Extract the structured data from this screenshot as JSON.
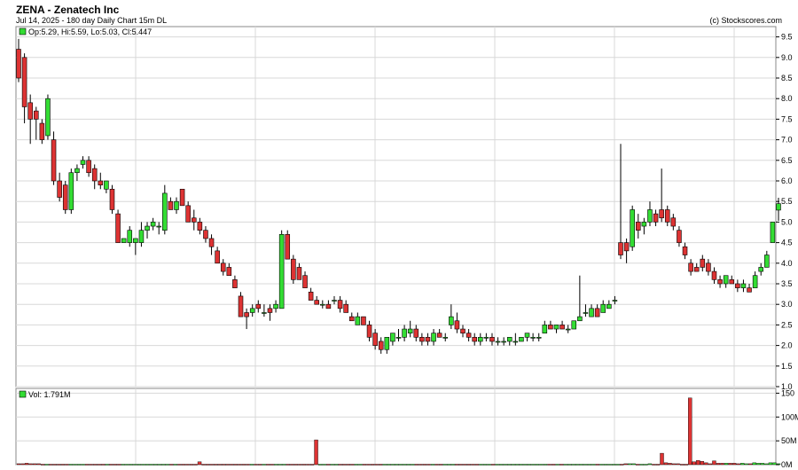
{
  "header": {
    "title": "ZENA - Zenatech Inc",
    "subtitle": "Jul 14, 2025 - 180 day  Daily Chart 15m DL",
    "copyright": "(c) Stockscores.com"
  },
  "price_legend": "Op:5.29, Hi:5.59, Lo:5.03, Cl:5.447",
  "volume_legend": "Vol: 1.791M",
  "colors": {
    "up": "#33dd33",
    "down": "#dd3333",
    "grid": "#d8d8d8",
    "frame": "#888888"
  },
  "chart_data": [
    {
      "type": "candlestick",
      "title": "ZENA - Zenatech Inc",
      "ylim": [
        1.0,
        9.75
      ],
      "yticks": [
        "1.0",
        "1.5",
        "2.0",
        "2.5",
        "3.0",
        "3.5",
        "4.0",
        "4.5",
        "5.0",
        "5.5",
        "6.0",
        "6.5",
        "7.0",
        "7.5",
        "8.0",
        "8.5",
        "9.0",
        "9.5"
      ],
      "grid": true,
      "candles": [
        [
          9.2,
          9.45,
          8.4,
          8.5
        ],
        [
          9.0,
          9.1,
          7.4,
          7.8
        ],
        [
          7.9,
          8.1,
          6.9,
          7.5
        ],
        [
          7.7,
          7.8,
          7.0,
          7.5
        ],
        [
          7.4,
          7.5,
          6.9,
          7.0
        ],
        [
          7.1,
          8.1,
          7.0,
          8.0
        ],
        [
          7.0,
          7.2,
          5.9,
          6.0
        ],
        [
          6.0,
          6.2,
          5.5,
          5.6
        ],
        [
          5.9,
          6.0,
          5.2,
          5.3
        ],
        [
          5.3,
          6.3,
          5.2,
          6.2
        ],
        [
          6.2,
          6.4,
          6.0,
          6.3
        ],
        [
          6.4,
          6.6,
          6.3,
          6.5
        ],
        [
          6.5,
          6.6,
          6.1,
          6.2
        ],
        [
          6.3,
          6.4,
          5.8,
          6.0
        ],
        [
          6.0,
          6.2,
          5.8,
          5.9
        ],
        [
          5.8,
          6.0,
          5.7,
          6.0
        ],
        [
          5.8,
          5.9,
          5.2,
          5.3
        ],
        [
          5.2,
          5.3,
          4.5,
          4.5
        ],
        [
          4.5,
          4.6,
          4.5,
          4.6
        ],
        [
          4.5,
          4.9,
          4.4,
          4.8
        ],
        [
          4.5,
          4.6,
          4.2,
          4.6
        ],
        [
          4.5,
          5.0,
          4.4,
          4.8
        ],
        [
          4.8,
          5.0,
          4.6,
          4.9
        ],
        [
          4.9,
          5.1,
          4.8,
          5.0
        ],
        [
          4.9,
          5.0,
          4.7,
          4.9
        ],
        [
          4.8,
          5.9,
          4.7,
          5.7
        ],
        [
          5.5,
          5.6,
          5.3,
          5.3
        ],
        [
          5.3,
          5.6,
          5.2,
          5.5
        ],
        [
          5.8,
          5.8,
          5.4,
          5.4
        ],
        [
          5.4,
          5.5,
          5.0,
          5.0
        ],
        [
          5.1,
          5.3,
          4.8,
          5.0
        ],
        [
          5.0,
          5.1,
          4.7,
          4.8
        ],
        [
          4.8,
          4.9,
          4.5,
          4.6
        ],
        [
          4.6,
          4.7,
          4.2,
          4.4
        ],
        [
          4.3,
          4.4,
          4.0,
          4.0
        ],
        [
          4.0,
          4.1,
          3.7,
          3.8
        ],
        [
          3.9,
          4.0,
          3.7,
          3.7
        ],
        [
          3.6,
          3.7,
          3.4,
          3.4
        ],
        [
          3.2,
          3.3,
          2.7,
          2.7
        ],
        [
          2.8,
          2.9,
          2.4,
          2.7
        ],
        [
          2.8,
          3.0,
          2.7,
          2.9
        ],
        [
          3.0,
          3.1,
          2.8,
          2.9
        ],
        [
          2.8,
          3.0,
          2.7,
          2.8
        ],
        [
          2.9,
          3.0,
          2.6,
          2.8
        ],
        [
          2.9,
          3.1,
          2.8,
          3.0
        ],
        [
          2.9,
          4.8,
          2.9,
          4.7
        ],
        [
          4.7,
          4.8,
          4.1,
          4.1
        ],
        [
          4.1,
          4.2,
          3.5,
          3.6
        ],
        [
          3.9,
          4.0,
          3.6,
          3.6
        ],
        [
          3.7,
          3.8,
          3.4,
          3.4
        ],
        [
          3.3,
          3.4,
          3.1,
          3.1
        ],
        [
          3.1,
          3.2,
          3.0,
          3.0
        ],
        [
          3.0,
          3.1,
          2.9,
          3.0
        ],
        [
          3.0,
          3.1,
          2.9,
          2.9
        ],
        [
          3.1,
          3.2,
          3.0,
          3.1
        ],
        [
          3.1,
          3.2,
          2.8,
          2.9
        ],
        [
          3.0,
          3.1,
          2.8,
          2.8
        ],
        [
          2.7,
          2.8,
          2.6,
          2.6
        ],
        [
          2.5,
          2.8,
          2.5,
          2.7
        ],
        [
          2.7,
          2.7,
          2.5,
          2.5
        ],
        [
          2.5,
          2.6,
          2.1,
          2.2
        ],
        [
          2.3,
          2.4,
          1.9,
          2.0
        ],
        [
          2.1,
          2.2,
          1.8,
          1.9
        ],
        [
          1.9,
          2.2,
          1.8,
          2.2
        ],
        [
          2.1,
          2.3,
          2.0,
          2.3
        ],
        [
          2.2,
          2.4,
          2.1,
          2.2
        ],
        [
          2.2,
          2.5,
          2.1,
          2.4
        ],
        [
          2.3,
          2.6,
          2.2,
          2.4
        ],
        [
          2.4,
          2.5,
          2.1,
          2.2
        ],
        [
          2.2,
          2.3,
          2.0,
          2.1
        ],
        [
          2.2,
          2.3,
          2.0,
          2.1
        ],
        [
          2.1,
          2.4,
          2.0,
          2.3
        ],
        [
          2.3,
          2.4,
          2.2,
          2.2
        ],
        [
          2.2,
          2.3,
          2.1,
          2.2
        ],
        [
          2.5,
          3.0,
          2.4,
          2.7
        ],
        [
          2.6,
          2.8,
          2.3,
          2.4
        ],
        [
          2.4,
          2.5,
          2.2,
          2.3
        ],
        [
          2.3,
          2.4,
          2.1,
          2.2
        ],
        [
          2.2,
          2.3,
          2.0,
          2.1
        ],
        [
          2.1,
          2.3,
          2.0,
          2.2
        ],
        [
          2.2,
          2.3,
          2.1,
          2.2
        ],
        [
          2.2,
          2.3,
          2.0,
          2.1
        ],
        [
          2.1,
          2.2,
          2.0,
          2.1
        ],
        [
          2.1,
          2.2,
          2.0,
          2.1
        ],
        [
          2.1,
          2.2,
          2.0,
          2.2
        ],
        [
          2.1,
          2.3,
          2.0,
          2.1
        ],
        [
          2.1,
          2.2,
          2.1,
          2.2
        ],
        [
          2.2,
          2.3,
          2.1,
          2.3
        ],
        [
          2.2,
          2.3,
          2.1,
          2.2
        ],
        [
          2.2,
          2.3,
          2.1,
          2.2
        ],
        [
          2.3,
          2.6,
          2.3,
          2.5
        ],
        [
          2.5,
          2.6,
          2.4,
          2.4
        ],
        [
          2.4,
          2.5,
          2.3,
          2.5
        ],
        [
          2.5,
          2.6,
          2.4,
          2.4
        ],
        [
          2.4,
          2.5,
          2.3,
          2.4
        ],
        [
          2.4,
          2.6,
          2.4,
          2.6
        ],
        [
          2.6,
          3.7,
          2.6,
          2.7
        ],
        [
          2.8,
          3.0,
          2.7,
          2.8
        ],
        [
          2.7,
          3.0,
          2.7,
          2.9
        ],
        [
          2.9,
          3.0,
          2.7,
          2.7
        ],
        [
          2.8,
          3.1,
          2.8,
          3.0
        ],
        [
          2.9,
          3.1,
          2.9,
          3.0
        ],
        [
          3.1,
          3.2,
          3.0,
          3.1
        ],
        [
          4.5,
          6.9,
          4.1,
          4.2
        ],
        [
          4.5,
          4.6,
          4.0,
          4.3
        ],
        [
          4.4,
          5.4,
          4.3,
          5.3
        ],
        [
          5.0,
          5.2,
          4.6,
          4.8
        ],
        [
          4.9,
          5.1,
          4.7,
          5.0
        ],
        [
          5.0,
          5.5,
          4.9,
          5.3
        ],
        [
          5.2,
          5.3,
          4.9,
          5.0
        ],
        [
          5.3,
          6.3,
          5.0,
          5.1
        ],
        [
          5.3,
          5.4,
          4.9,
          5.0
        ],
        [
          5.1,
          5.2,
          4.8,
          4.9
        ],
        [
          4.8,
          4.9,
          4.4,
          4.5
        ],
        [
          4.4,
          4.5,
          4.1,
          4.2
        ],
        [
          4.0,
          4.1,
          3.7,
          3.8
        ],
        [
          3.9,
          4.0,
          3.8,
          3.8
        ],
        [
          4.1,
          4.2,
          3.8,
          3.9
        ],
        [
          4.0,
          4.1,
          3.7,
          3.8
        ],
        [
          3.8,
          3.9,
          3.5,
          3.6
        ],
        [
          3.6,
          3.7,
          3.4,
          3.5
        ],
        [
          3.5,
          3.7,
          3.4,
          3.7
        ],
        [
          3.6,
          3.7,
          3.5,
          3.5
        ],
        [
          3.5,
          3.6,
          3.3,
          3.4
        ],
        [
          3.4,
          3.6,
          3.3,
          3.5
        ],
        [
          3.4,
          3.5,
          3.3,
          3.3
        ],
        [
          3.4,
          3.8,
          3.4,
          3.7
        ],
        [
          3.8,
          4.0,
          3.7,
          3.9
        ],
        [
          3.9,
          4.3,
          3.9,
          4.2
        ],
        [
          4.5,
          5.0,
          4.5,
          5.0
        ],
        [
          5.29,
          5.59,
          5.03,
          5.447
        ]
      ]
    },
    {
      "type": "bar",
      "title": "Vol: 1.791M",
      "ylim": [
        0,
        160
      ],
      "yticks": [
        "0M",
        "50M",
        "100M",
        "150"
      ],
      "note": "volume in millions, bar colored by candle direction",
      "values": [
        2,
        2,
        3,
        2,
        2,
        2,
        1,
        1,
        1,
        1,
        1,
        1,
        1,
        1,
        1,
        1,
        1,
        1,
        1,
        1,
        1,
        1,
        1,
        1,
        1,
        1,
        1,
        1,
        1,
        1,
        1,
        1,
        1,
        1,
        1,
        1,
        1,
        1,
        1,
        1,
        1,
        1,
        1,
        1,
        1,
        6,
        1,
        1,
        1,
        1,
        1,
        1,
        1,
        1,
        1,
        1,
        1,
        1,
        1,
        1,
        1,
        1,
        1,
        1,
        1,
        1,
        1,
        1,
        1,
        1,
        1,
        1,
        1,
        1,
        52,
        1,
        1,
        1,
        1,
        1,
        1,
        1,
        1,
        1,
        1,
        1,
        1,
        1,
        1,
        1,
        1,
        1,
        1,
        1,
        1,
        1,
        1,
        1,
        1,
        1,
        1,
        1,
        1,
        1,
        1,
        1,
        1,
        1,
        1,
        1,
        1,
        1,
        1,
        1,
        1,
        1,
        1,
        1,
        1,
        1,
        1,
        1,
        1,
        1,
        1,
        1,
        1,
        1,
        1,
        1,
        1,
        1,
        1,
        1,
        1,
        1,
        1,
        1,
        1,
        1,
        1,
        1,
        1,
        1,
        1,
        1,
        1,
        1,
        1,
        1,
        1,
        2,
        2,
        2,
        1,
        1,
        1,
        2,
        1,
        1,
        24,
        4,
        3,
        2,
        2,
        1,
        1,
        140,
        6,
        9,
        7,
        4,
        2,
        8,
        3,
        3,
        3,
        3,
        3,
        2,
        3,
        2,
        2,
        4,
        3,
        3,
        2,
        4,
        4,
        2
      ]
    }
  ]
}
